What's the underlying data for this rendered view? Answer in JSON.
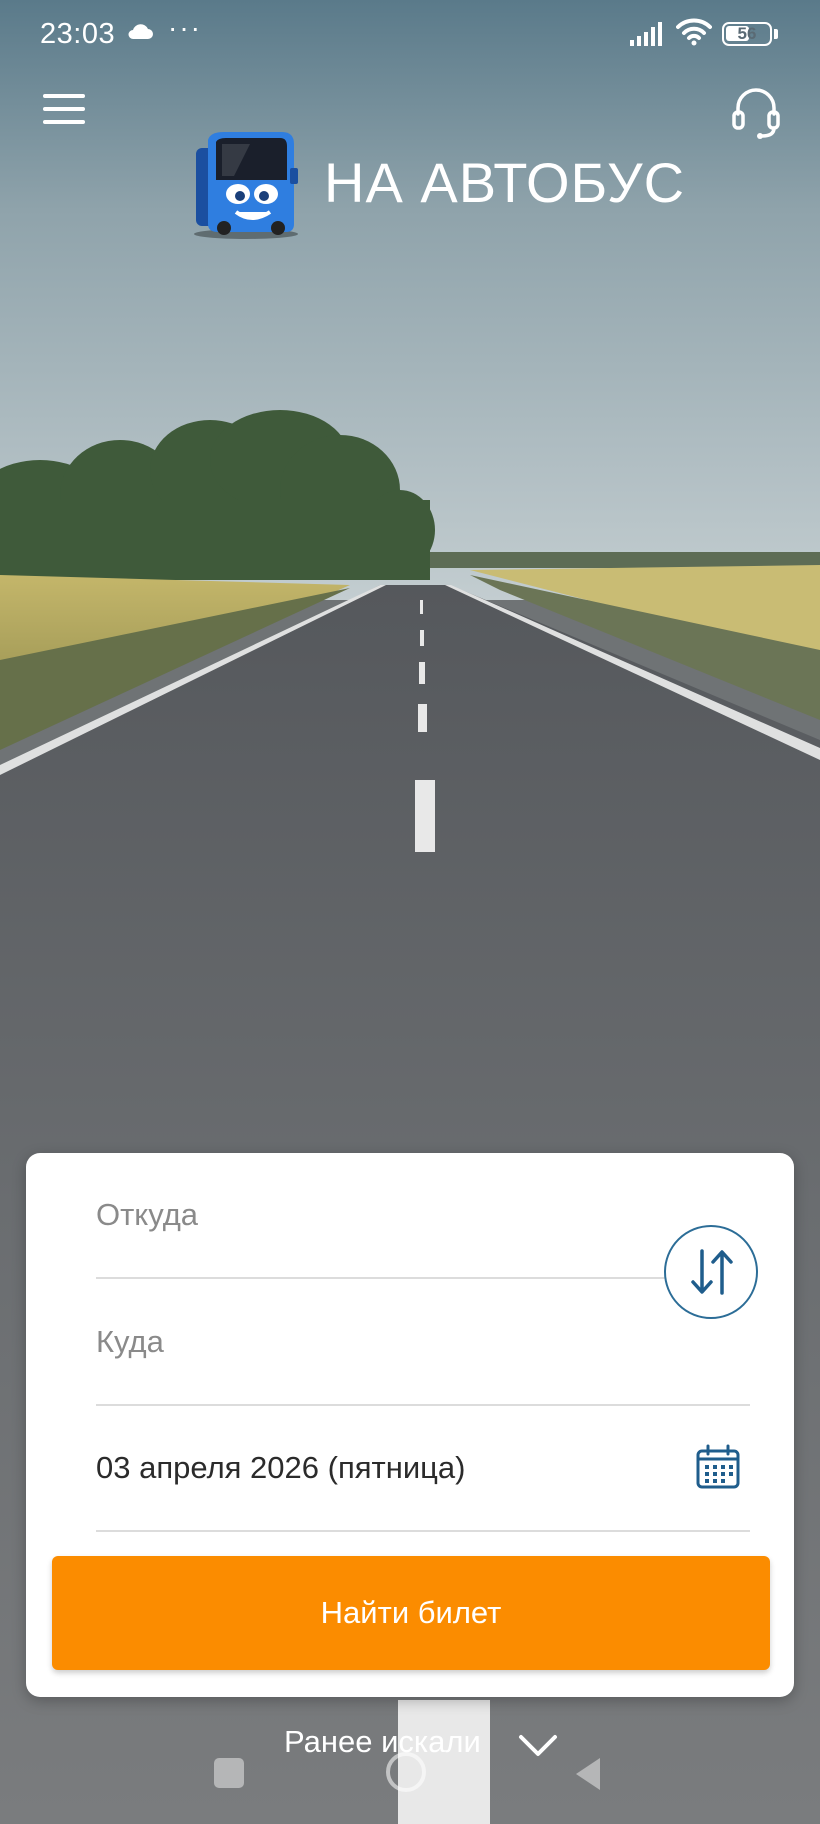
{
  "status_bar": {
    "time": "23:03",
    "more": "···",
    "battery_level": "56",
    "battery_percent": 56
  },
  "header": {
    "app_name": "НА АВТОБУС",
    "menu_icon": "hamburger-menu-icon",
    "support_icon": "headset-icon",
    "logo_icon": "bus-mascot-logo"
  },
  "search": {
    "from_placeholder": "Откуда",
    "to_placeholder": "Куда",
    "date_value": "03 апреля 2026 (пятница)",
    "swap_icon": "swap-arrows-icon",
    "calendar_icon": "calendar-icon",
    "find_button_label": "Найти билет"
  },
  "footer": {
    "history_label": "Ранее искали",
    "history_icon": "chevron-down-icon"
  },
  "colors": {
    "accent_orange": "#fb8c00",
    "accent_blue": "#2c6d97",
    "card_bg": "#ffffff"
  }
}
